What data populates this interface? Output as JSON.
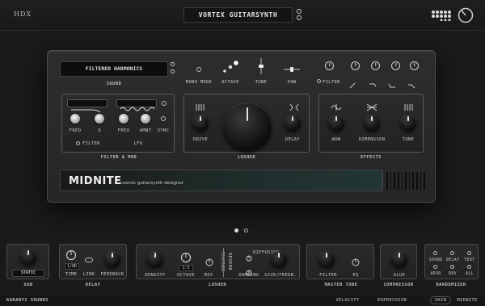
{
  "header": {
    "logo": "HDX",
    "preset_name": "VORTEX GUITARSYNTH"
  },
  "sound_section": {
    "display": "FILTERED HARMONICS",
    "label": "SOUND",
    "mono_mode": "MONO MODE",
    "octave": "OCTAVE",
    "tune": "TUNE",
    "pan": "PAN",
    "filter_toggle": "FILTER"
  },
  "filter_mod": {
    "freq": "FREQ",
    "q": "Q",
    "freq2": "FREQ",
    "amnt": "AMNT",
    "sync": "SYNC",
    "filter": "FILTER",
    "lfo": "LFO",
    "label": "FILTER & MOD"
  },
  "lusher": {
    "drive": "DRIVE",
    "delay": "DELAY",
    "label": "LUSHER"
  },
  "effects": {
    "wow": "WOW",
    "dimension": "DIMENSION",
    "tone": "TONE",
    "label": "EFFECTS"
  },
  "brand": {
    "title": "MIDNITE",
    "tagline": "cosmic guitarsynth designer"
  },
  "bottom": {
    "sub_value": "STATIC",
    "sub_label": "SUB",
    "delay_time": "TIME",
    "delay_time_val": "1/8D",
    "delay_link": "LINK",
    "delay_feedback": "FEEDBACK",
    "delay_label": "DELAY",
    "density": "DENSITY",
    "octave": "OCTAVE",
    "octave_val": "1:3",
    "mix": "MIX",
    "texture": "TEXTURE",
    "reverb": "REVERB",
    "diffusion": "DIFFUSION",
    "damping": "DAMPING",
    "size": "SIZE/FEEDB.",
    "lusher_label": "LUSHER",
    "filter": "FILTER",
    "eq": "EQ",
    "master_tone_label": "MASTER TONE",
    "glue": "GLUE",
    "compressor_label": "COMPRESSOR",
    "rand_sound": "SOUND",
    "rand_delay": "DELAY",
    "rand_text": "TEXT",
    "rand_adsr": "ADSR",
    "rand_rev": "REV",
    "rand_all": "ALL",
    "randomizer_label": "RANDOMIZER"
  },
  "footer": {
    "company": "KARANYI SOUNDS",
    "velocity": "VELOCITY",
    "expression": "EXPRESSION",
    "skin": "SKIN",
    "skin_value": "MIDNITE"
  }
}
